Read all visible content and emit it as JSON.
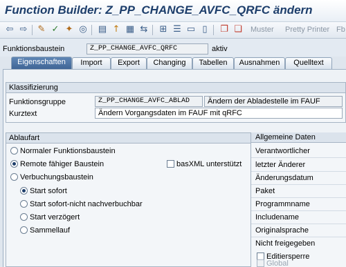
{
  "title": "Function Builder: Z_PP_CHANGE_AVFC_QRFC ändern",
  "toolbar": {
    "icons": [
      "back-arrow-icon",
      "forward-arrow-icon",
      "display-change-icon",
      "check-icon",
      "activate-icon",
      "where-used-icon",
      "object-list-icon",
      "navigate-icon",
      "display-object-icon",
      "test-icon",
      "hierarchy-icon",
      "bookmark-icon",
      "help-icon",
      "pattern-icon",
      "muster-icon"
    ],
    "muster": "Muster",
    "pretty_printer": "Pretty Printer",
    "more": "Fb"
  },
  "header": {
    "label": "Funktionsbaustein",
    "value": "Z_PP_CHANGE_AVFC_QRFC",
    "status": "aktiv"
  },
  "tabs": [
    "Eigenschaften",
    "Import",
    "Export",
    "Changing",
    "Tabellen",
    "Ausnahmen",
    "Quelltext"
  ],
  "classification": {
    "heading": "Klassifizierung",
    "group_label": "Funktionsgruppe",
    "group_value": "Z_PP_CHANGE_AVFC_ABLAD",
    "group_desc": "Ändern der Abladestelle im FAUF",
    "short_label": "Kurztext",
    "short_value": "Ändern Vorgangsdaten im FAUF mit qRFC"
  },
  "ablauf": {
    "heading": "Ablaufart",
    "normal": "Normaler Funktionsbaustein",
    "remote": "Remote fähiger Baustein",
    "basxml": "basXML unterstützt",
    "update": "Verbuchungsbaustein",
    "start_now": "Start sofort",
    "start_now_no": "Start sofort-nicht nachverbuchbar",
    "start_delayed": "Start verzögert",
    "collective": "Sammellauf"
  },
  "general": {
    "heading": "Allgemeine Daten",
    "items": [
      "Verantwortlicher",
      "letzter Änderer",
      "Änderungsdatum",
      "Paket",
      "Programmname",
      "Includename",
      "Originalsprache",
      "Nicht freigegeben"
    ],
    "edit_lock": "Editiersperre",
    "global": "Global"
  }
}
